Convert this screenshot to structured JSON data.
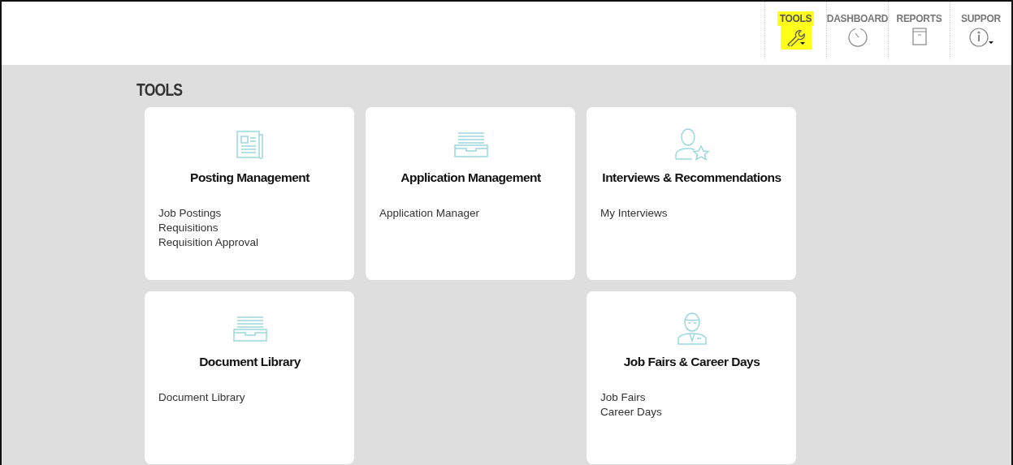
{
  "nav": [
    {
      "label": "TOOLS",
      "selected": true
    },
    {
      "label": "DASHBOARD",
      "selected": false
    },
    {
      "label": "REPORTS",
      "selected": false
    },
    {
      "label": "SUPPOR",
      "selected": false
    }
  ],
  "heading": "TOOLS",
  "cards": [
    {
      "kind": "card",
      "title": "Posting Management",
      "links": [
        "Job Postings",
        "Requisitions",
        "Requisition Approval"
      ]
    },
    {
      "kind": "card",
      "title": "Application Management",
      "links": [
        "Application Manager"
      ]
    },
    {
      "kind": "card",
      "title": "Interviews & Recommendations",
      "links": [
        "My Interviews"
      ]
    },
    {
      "kind": "card",
      "title": "Document Library",
      "links": [
        "Document Library"
      ]
    },
    {
      "kind": "blank"
    },
    {
      "kind": "card",
      "title": "Job Fairs & Career Days",
      "links": [
        "Job Fairs",
        "Career Days"
      ]
    }
  ]
}
